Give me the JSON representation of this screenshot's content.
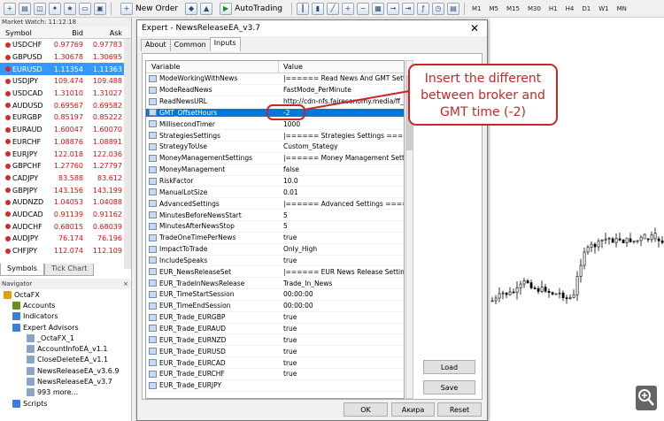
{
  "toolbar": {
    "new_order": "New Order",
    "autotrading": "AutoTrading",
    "timeframes": [
      "M1",
      "M5",
      "M15",
      "M30",
      "H1",
      "H4",
      "D1",
      "W1",
      "MN"
    ]
  },
  "market_watch": {
    "title": "Market Watch: 11:12:18",
    "headers": {
      "symbol": "Symbol",
      "bid": "Bid",
      "ask": "Ask"
    },
    "rows": [
      {
        "symbol": "USDCHF",
        "bid": "0.97769",
        "ask": "0.97783"
      },
      {
        "symbol": "GBPUSD",
        "bid": "1.30678",
        "ask": "1.30695"
      },
      {
        "symbol": "EURUSD",
        "bid": "1.11354",
        "ask": "1.11363"
      },
      {
        "symbol": "USDJPY",
        "bid": "109.474",
        "ask": "109.488"
      },
      {
        "symbol": "USDCAD",
        "bid": "1.31010",
        "ask": "1.31027"
      },
      {
        "symbol": "AUDUSD",
        "bid": "0.69567",
        "ask": "0.69582"
      },
      {
        "symbol": "EURGBP",
        "bid": "0.85197",
        "ask": "0.85222"
      },
      {
        "symbol": "EURAUD",
        "bid": "1.60047",
        "ask": "1.60070"
      },
      {
        "symbol": "EURCHF",
        "bid": "1.08876",
        "ask": "1.08891"
      },
      {
        "symbol": "EURJPY",
        "bid": "122.018",
        "ask": "122.036"
      },
      {
        "symbol": "GBPCHF",
        "bid": "1.27760",
        "ask": "1.27797"
      },
      {
        "symbol": "CADJPY",
        "bid": "83.588",
        "ask": "83.612"
      },
      {
        "symbol": "GBPJPY",
        "bid": "143.156",
        "ask": "143.199"
      },
      {
        "symbol": "AUDNZD",
        "bid": "1.04053",
        "ask": "1.04088"
      },
      {
        "symbol": "AUDCAD",
        "bid": "0.91139",
        "ask": "0.91162"
      },
      {
        "symbol": "AUDCHF",
        "bid": "0.68015",
        "ask": "0.68039"
      },
      {
        "symbol": "AUDJPY",
        "bid": "76.174",
        "ask": "76.196"
      },
      {
        "symbol": "CHFJPY",
        "bid": "112.074",
        "ask": "112.109"
      }
    ],
    "tabs": [
      "Symbols",
      "Tick Chart"
    ]
  },
  "navigator": {
    "title": "Navigator",
    "items": [
      "OctaFX",
      "Accounts",
      "Indicators",
      "Expert Advisors",
      "_OctaFX_1",
      "AccountInfoEA_v1.1",
      "CloseDeleteEA_v1.1",
      "NewsReleaseEA_v3.6.9",
      "NewsReleaseEA_v3.7",
      "993 more...",
      "Scripts"
    ]
  },
  "dialog": {
    "title": "Expert - NewsReleaseEA_v3.7",
    "tabs": [
      "About",
      "Common",
      "Inputs"
    ],
    "headers": {
      "variable": "Variable",
      "value": "Value"
    },
    "rows": [
      {
        "var": "ModeWorkingWithNews",
        "val": "|====== Read News And GMT Settings =..."
      },
      {
        "var": "ModeReadNews",
        "val": "FastMode_PerMinute"
      },
      {
        "var": "ReadNewsURL",
        "val": "http://cdn-nfs.faireconomy.media/ff_calen..."
      },
      {
        "var": "GMT_OffsetHours",
        "val": "-2"
      },
      {
        "var": "MillisecondTimer",
        "val": "1000"
      },
      {
        "var": "StrategiesSettings",
        "val": "|====== Strategies Settings ======|"
      },
      {
        "var": "StrategyToUse",
        "val": "Custom_Stategy"
      },
      {
        "var": "MoneyManagementSettings",
        "val": "|====== Money Management Settings ===..."
      },
      {
        "var": "MoneyManagement",
        "val": "false"
      },
      {
        "var": "RiskFactor",
        "val": "10.0"
      },
      {
        "var": "ManualLotSize",
        "val": "0.01"
      },
      {
        "var": "AdvancedSettings",
        "val": "|====== Advanced Settings ======|"
      },
      {
        "var": "MinutesBeforeNewsStart",
        "val": "5"
      },
      {
        "var": "MinutesAfterNewsStop",
        "val": "5"
      },
      {
        "var": "TradeOneTimePerNews",
        "val": "true"
      },
      {
        "var": "ImpactToTrade",
        "val": "Only_High"
      },
      {
        "var": "IncludeSpeaks",
        "val": "true"
      },
      {
        "var": "EUR_NewsReleaseSet",
        "val": "|====== EUR News Release Settings ===..."
      },
      {
        "var": "EUR_TradeInNewsRelease",
        "val": "Trade_In_News"
      },
      {
        "var": "EUR_TimeStartSession",
        "val": "00:00:00"
      },
      {
        "var": "EUR_TimeEndSession",
        "val": "00:00:00"
      },
      {
        "var": "EUR_Trade_EURGBP",
        "val": "true"
      },
      {
        "var": "EUR_Trade_EURAUD",
        "val": "true"
      },
      {
        "var": "EUR_Trade_EURNZD",
        "val": "true"
      },
      {
        "var": "EUR_Trade_EURUSD",
        "val": "true"
      },
      {
        "var": "EUR_Trade_EURCAD",
        "val": "true"
      },
      {
        "var": "EUR_Trade_EURCHF",
        "val": "true"
      },
      {
        "var": "EUR_Trade_EURJPY",
        "val": ""
      }
    ],
    "buttons": {
      "load": "Load",
      "save": "Save",
      "ok": "OK",
      "cancel": "Акира",
      "reset": "Reset"
    }
  },
  "annotation": {
    "text": "Insert the different between broker and GMT time (-2)"
  }
}
